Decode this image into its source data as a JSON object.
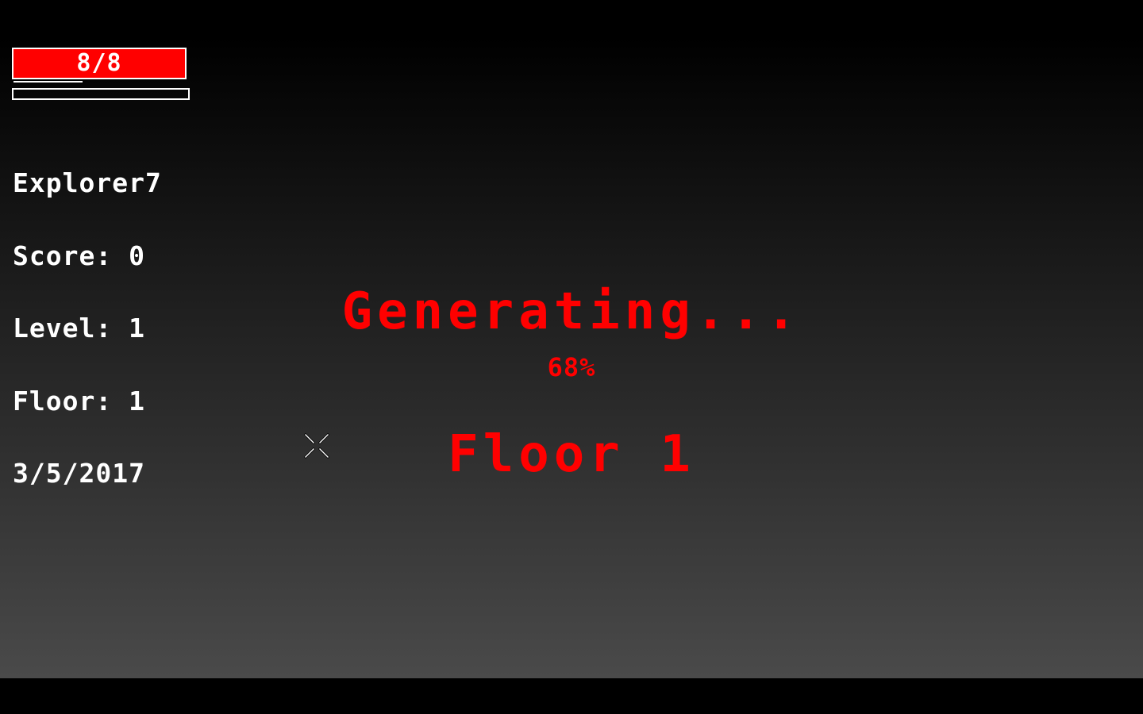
{
  "hud": {
    "health": {
      "label": "8/8",
      "current": 8,
      "max": 8,
      "fraction": 1.0,
      "color": "#ff0000"
    },
    "experience": {
      "fraction": 0.0
    },
    "player_name": "Explorer7",
    "score": "Score: 0",
    "level": "Level: 1",
    "floor": "Floor: 1",
    "date": "3/5/2017"
  },
  "loading": {
    "line1": "Generating...",
    "line2": "Floor 1",
    "progress_text": "68%",
    "progress": 0.68,
    "color": "#ff0000"
  },
  "cursor": {
    "icon": "crosshair-icon"
  }
}
